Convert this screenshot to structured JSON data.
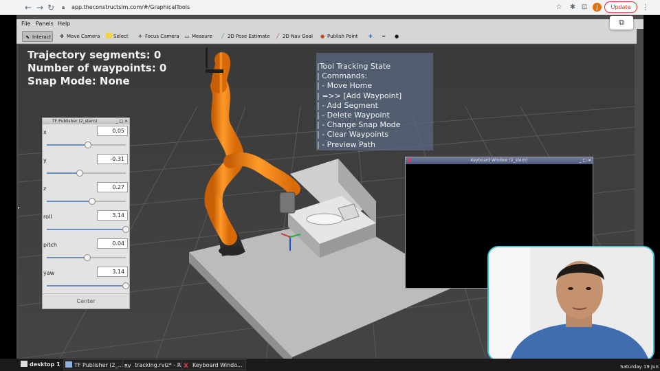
{
  "browser": {
    "url": "app.theconstructsim.com/#/GraphicalTools",
    "avatar_letter": "J",
    "update_label": "Update",
    "icons": [
      "back-icon",
      "forward-icon",
      "reload-icon",
      "lock-icon",
      "star-icon",
      "extensions-icon",
      "sync-icon"
    ]
  },
  "app": {
    "menu": {
      "file": "File",
      "panels": "Panels",
      "help": "Help"
    },
    "toolbar": {
      "interact": "Interact",
      "move_camera": "Move Camera",
      "select": "Select",
      "focus_camera": "Focus Camera",
      "measure": "Measure",
      "pose_estimate": "2D Pose Estimate",
      "nav_goal": "2D Nav Goal",
      "publish_point": "Publish Point"
    },
    "colors": {
      "robot_orange": "#f07f0f",
      "viewport_bg": "#3d3d3d",
      "webcam_border": "#42c8d8"
    }
  },
  "viewport": {
    "stats": {
      "line1": "Trajectory segments: 0",
      "line2": "Number of waypoints: 0",
      "line3": "Snap Mode: None"
    },
    "tool_state": {
      "lines": [
        "|Tool Tracking State",
        "| Commands:",
        "| - Move Home",
        "| =>> [Add Waypoint]",
        "| - Add Segment",
        "| - Delete Waypoint",
        "| - Change Snap Mode",
        "| - Clear Waypoints",
        "| - Preview Path"
      ]
    }
  },
  "tf_publisher": {
    "title": "TF Publisher (2_stern)",
    "rows": [
      {
        "label": "x",
        "value": "0.05",
        "level": 0.52
      },
      {
        "label": "y",
        "value": "-0.31",
        "level": 0.42
      },
      {
        "label": "z",
        "value": "0.27",
        "level": 0.57
      },
      {
        "label": "roll",
        "value": "3.14",
        "level": 1.0
      },
      {
        "label": "pitch",
        "value": "0.04",
        "level": 0.51
      },
      {
        "label": "yaw",
        "value": "3.14",
        "level": 1.0
      }
    ],
    "center_label": "Center"
  },
  "keyboard_window": {
    "title": "Keyboard Window (2_stern)"
  },
  "taskbar": {
    "desktop": "desktop 1",
    "tf_task": "TF Publisher (2_...",
    "rviz_task": "tracking.rviz* - R...",
    "kb_task": "Keyboard Windo...",
    "date": "Saturday 19 Jun"
  }
}
